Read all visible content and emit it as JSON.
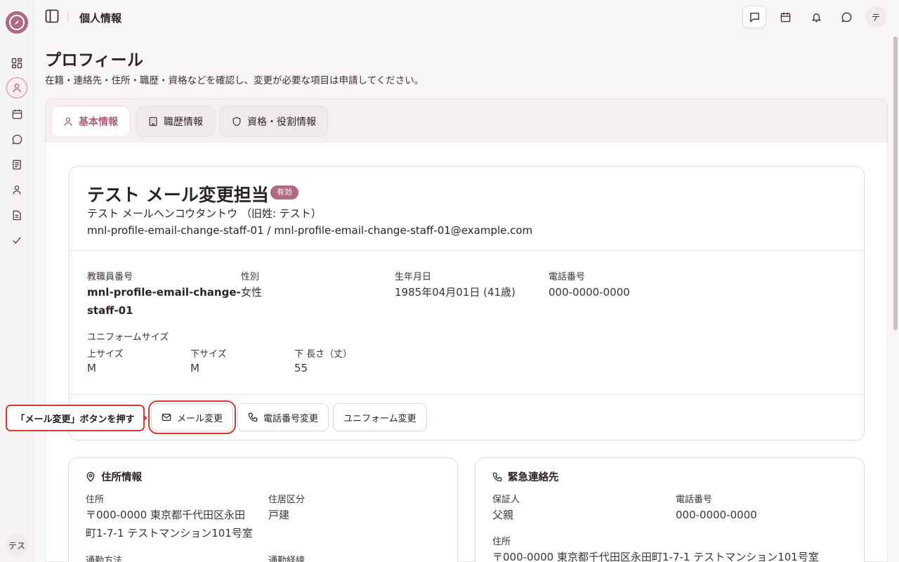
{
  "header": {
    "breadcrumb": "個人情報",
    "user_avatar": "テ"
  },
  "sidebar": {
    "items": [
      {
        "icon": "dashboard-icon"
      },
      {
        "icon": "user-icon",
        "active": true
      },
      {
        "icon": "calendar-icon"
      },
      {
        "icon": "chat-icon"
      },
      {
        "icon": "book-icon"
      },
      {
        "icon": "person-icon"
      },
      {
        "icon": "document-icon"
      },
      {
        "icon": "check-icon"
      }
    ],
    "avatar": "テス"
  },
  "page": {
    "title": "プロフィール",
    "description": "在籍・連絡先・住所・職歴・資格などを確認し、変更が必要な項目は申請してください。"
  },
  "tabs": [
    {
      "label": "基本情報",
      "icon": "user-icon",
      "active": true
    },
    {
      "label": "職歴情報",
      "icon": "building-icon"
    },
    {
      "label": "資格・役割情報",
      "icon": "shield-icon"
    }
  ],
  "profile": {
    "name": "テスト メール変更担当",
    "status_badge": "有効",
    "kana": "テスト メールヘンコウタントウ （旧姓: テスト）",
    "email_line": "mnl-profile-email-change-staff-01 / mnl-profile-email-change-staff-01@example.com",
    "fields": {
      "staff_no_label": "教職員番号",
      "staff_no_line1": "mnl-profile-email-change-",
      "staff_no_line2": "staff-01",
      "gender_label": "性別",
      "gender": "女性",
      "birth_label": "生年月日",
      "birth": "1985年04月01日 (41歳)",
      "phone_label": "電話番号",
      "phone": "000-0000-0000"
    },
    "uniform": {
      "title": "ユニフォームサイズ",
      "top_label": "上サイズ",
      "top": "M",
      "bottom_label": "下サイズ",
      "bottom": "M",
      "length_label": "下 長さ（丈）",
      "length": "55"
    },
    "actions": {
      "email_change": "メール変更",
      "phone_change": "電話番号変更",
      "uniform_change": "ユニフォーム変更"
    }
  },
  "callout": "「メール変更」ボタンを押す",
  "address": {
    "title": "住所情報",
    "address_label": "住所",
    "address_line1": "〒000-0000 東京都千代田区永田",
    "address_line2": "町1-7-1 テストマンション101号室",
    "residence_label": "住居区分",
    "residence": "戸建",
    "commute_label": "通勤方法",
    "route_label": "通勤経緯"
  },
  "emergency": {
    "title": "緊急連絡先",
    "guarantor_label": "保証人",
    "guarantor": "父親",
    "phone_label": "電話番号",
    "phone": "000-0000-0000",
    "address_label": "住所",
    "address": "〒000-0000 東京都千代田区永田町1-7-1 テストマンション101号室"
  }
}
